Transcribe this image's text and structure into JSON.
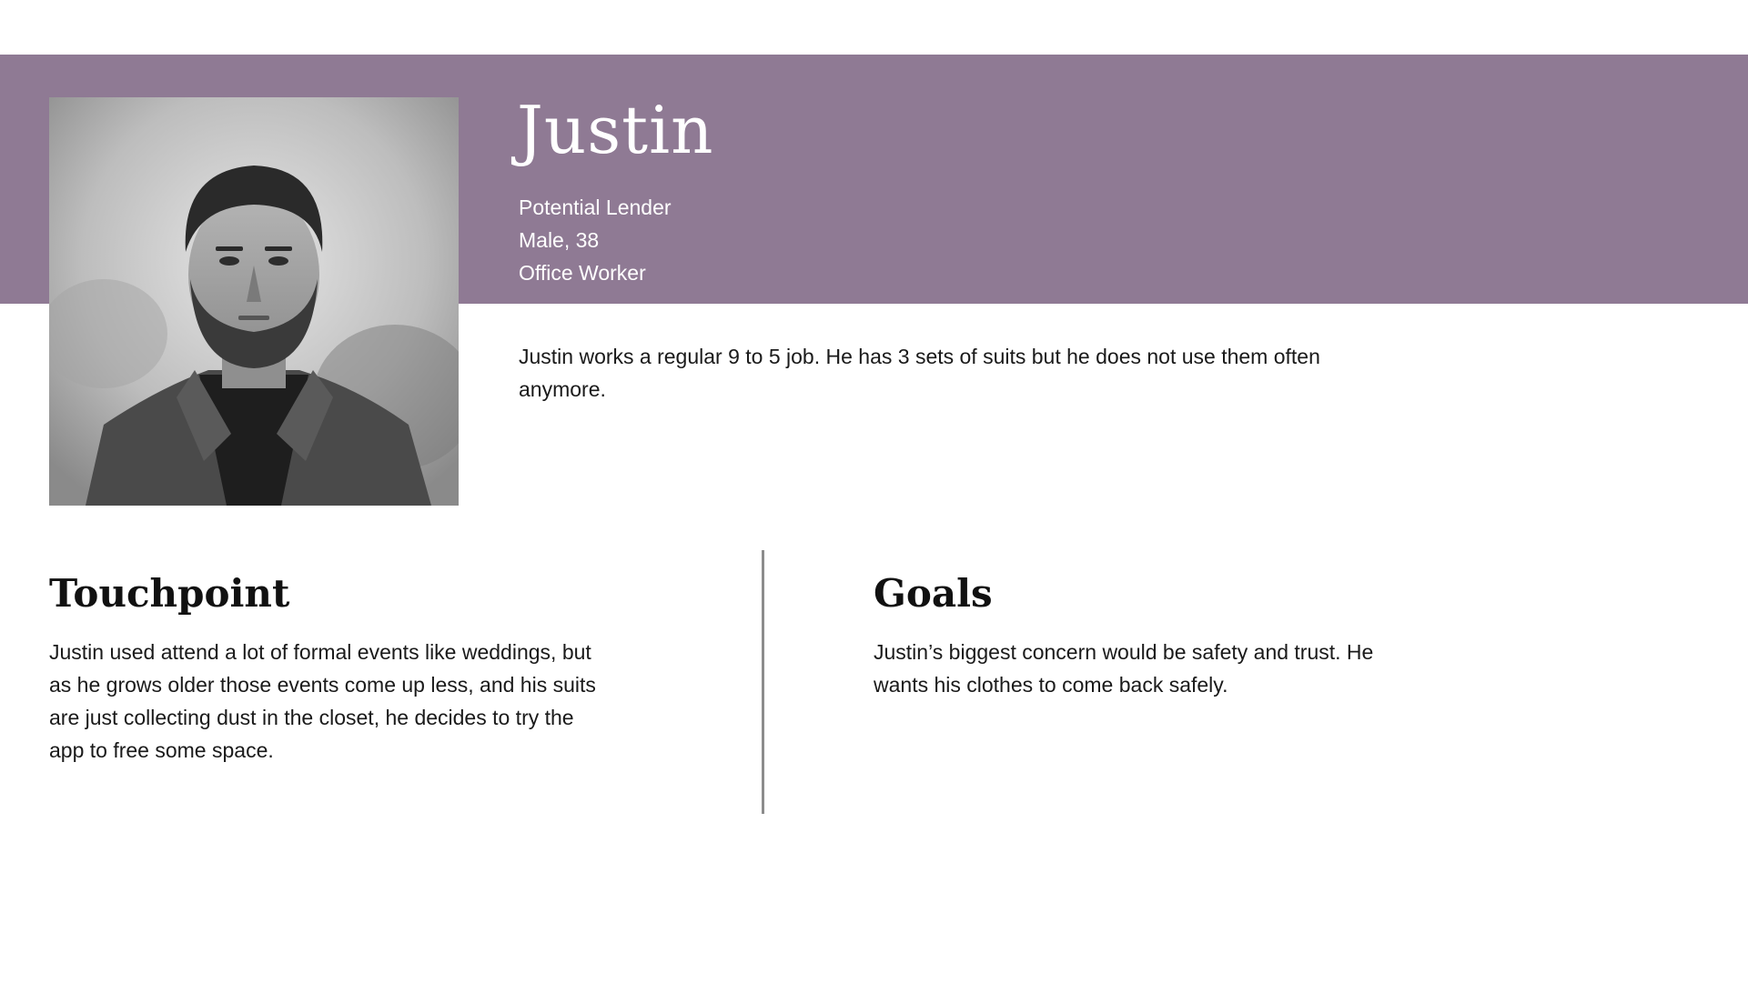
{
  "persona": {
    "name": "Justin",
    "facts": [
      "Potential Lender",
      "Male, 38",
      "Office Worker"
    ],
    "bio": "Justin works a regular 9 to 5 job. He has 3 sets of suits but he does not use them often anymore."
  },
  "touchpoint": {
    "title": "Touchpoint",
    "body": "Justin used attend a lot of formal events like weddings, but as he grows older those events come up less, and his suits are just collecting dust in the closet, he decides to try the app to free some space."
  },
  "goals": {
    "title": "Goals",
    "body": "Justin’s biggest concern would be safety and trust. He wants his clothes to come back safely."
  },
  "colors": {
    "header_band": "#8f7a94",
    "divider": "#8c8c8c"
  }
}
